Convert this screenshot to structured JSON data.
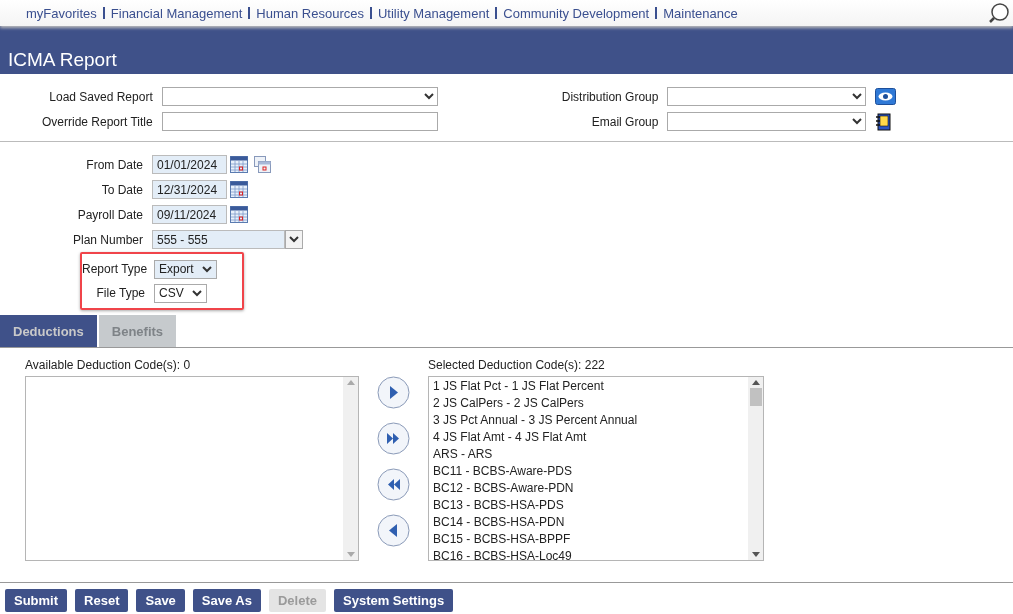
{
  "nav": {
    "items": [
      "myFavorites",
      "Financial Management",
      "Human Resources",
      "Utility Management",
      "Community Development",
      "Maintenance"
    ]
  },
  "header": {
    "title": "ICMA Report"
  },
  "report_options": {
    "left": [
      {
        "label": "Load Saved Report",
        "kind": "select"
      },
      {
        "label": "Override Report Title",
        "kind": "text"
      }
    ],
    "right": [
      {
        "label": "Distribution Group",
        "kind": "select"
      },
      {
        "label": "Email Group",
        "kind": "select"
      }
    ]
  },
  "parameters": [
    {
      "label": "From Date",
      "kind": "date",
      "value": "01/01/2024",
      "highlighted": false
    },
    {
      "label": "To Date",
      "kind": "date",
      "value": "12/31/2024",
      "highlighted": false
    },
    {
      "label": "Payroll Date",
      "kind": "date",
      "value": "09/11/2024",
      "highlighted": false
    },
    {
      "label": "Plan Number",
      "kind": "combo",
      "value": "555 - 555",
      "highlighted": false
    },
    {
      "label": "Report Type",
      "kind": "select",
      "value": "Export",
      "highlighted": true
    },
    {
      "label": "File Type",
      "kind": "select",
      "value": "CSV",
      "highlighted": true
    }
  ],
  "tabs": [
    {
      "label": "Deductions",
      "selected": true
    },
    {
      "label": "Benefits",
      "selected": false
    }
  ],
  "available_codes": {
    "label": "Available Deduction Code(s): 0"
  },
  "selected_codes": {
    "label": "Selected Deduction Code(s): 222",
    "items": [
      "1 JS Flat Pct - 1 JS Flat Percent",
      "2 JS CalPers - 2 JS CalPers",
      "3 JS Pct Annual - 3 JS Percent Annual",
      "4 JS Flat Amt - 4 JS Flat Amt",
      "ARS - ARS",
      "BC11 - BCBS-Aware-PDS",
      "BC12 - BCBS-Aware-PDN",
      "BC13 - BCBS-HSA-PDS",
      "BC14 - BCBS-HSA-PDN",
      "BC15 - BCBS-HSA-BPPF",
      "BC16 - BCBS-HSA-Loc49"
    ]
  },
  "buttons": [
    {
      "label": "Submit",
      "disabled": false
    },
    {
      "label": "Reset",
      "disabled": false
    },
    {
      "label": "Save",
      "disabled": false
    },
    {
      "label": "Save As",
      "disabled": false
    },
    {
      "label": "Delete",
      "disabled": true
    },
    {
      "label": "System Settings",
      "disabled": false
    }
  ]
}
